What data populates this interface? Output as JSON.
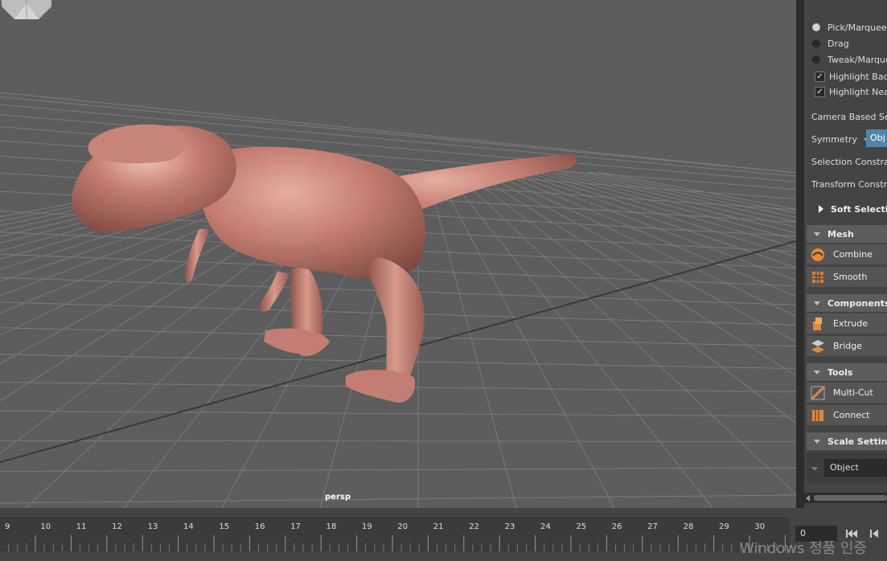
{
  "viewport": {
    "camera_label": "persp"
  },
  "tool_settings": {
    "radios": [
      {
        "label": "Pick/Marquee",
        "selected": true
      },
      {
        "label": "Drag",
        "selected": false
      },
      {
        "label": "Tweak/Marquee",
        "selected": false
      }
    ],
    "checkboxes": [
      {
        "label": "Highlight Back",
        "checked": true
      },
      {
        "label": "Highlight Nea",
        "checked": true
      }
    ],
    "camera_based": "Camera Based Sele",
    "symmetry_label": "Symmetry",
    "symmetry_value": "Obj",
    "selection_constraint": "Selection Constrai",
    "transform_constraint": "Transform Constra",
    "soft_selection": "Soft Selection"
  },
  "shelf": {
    "mesh": {
      "title": "Mesh",
      "tools": [
        "Combine",
        "Smooth"
      ]
    },
    "components": {
      "title": "Components",
      "tools": [
        "Extrude",
        "Bridge"
      ]
    },
    "tools": {
      "title": "Tools",
      "tools": [
        "Multi-Cut",
        "Connect"
      ]
    },
    "scale_settings": {
      "title": "Scale Settings",
      "value": "Object"
    }
  },
  "timeline": {
    "ticks": [
      "9",
      "10",
      "11",
      "12",
      "13",
      "14",
      "15",
      "16",
      "17",
      "18",
      "19",
      "20",
      "21",
      "22",
      "23",
      "24",
      "25",
      "26",
      "27",
      "28",
      "29",
      "30"
    ],
    "current_frame": "0"
  },
  "watermark": "Windows 정품 인증",
  "colors": {
    "viewport_bg": "#5d5d5d",
    "model": "#c07a70",
    "accent": "#5285a6"
  }
}
